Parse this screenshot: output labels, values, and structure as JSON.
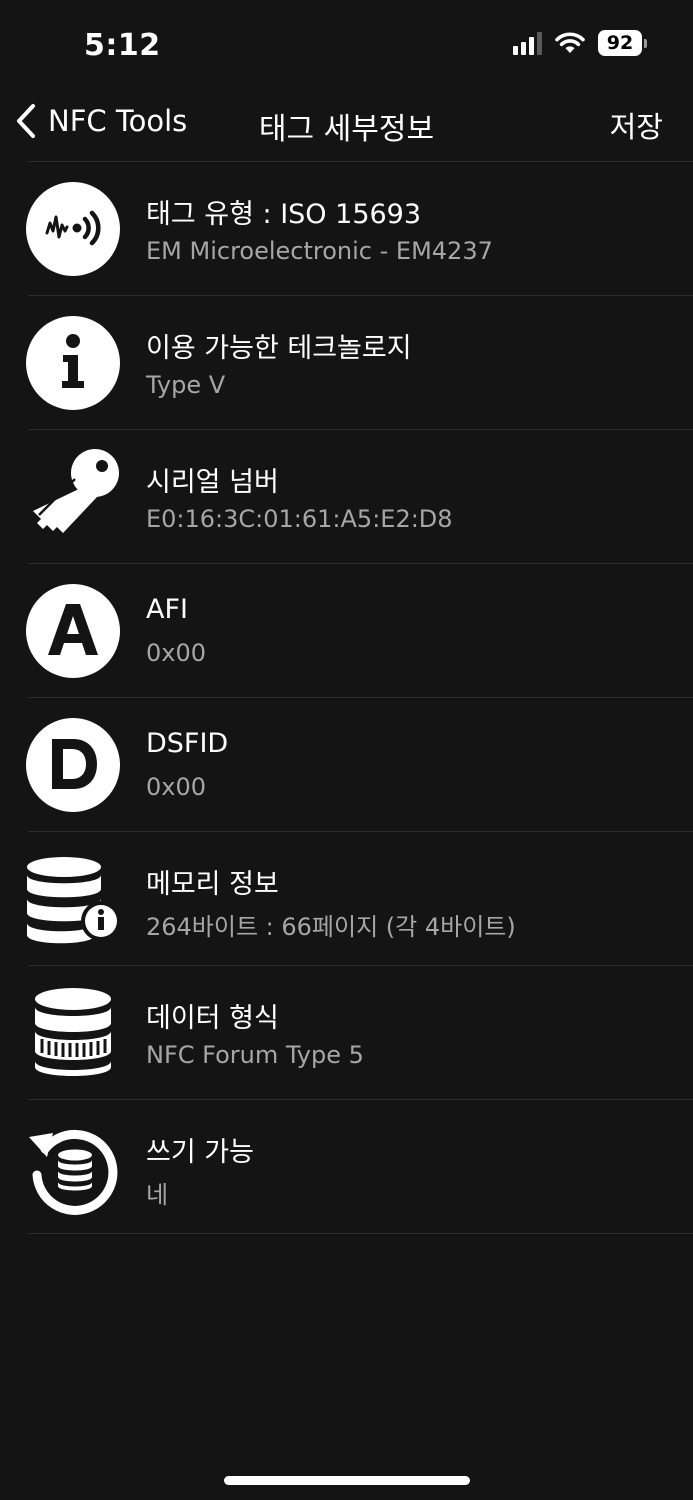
{
  "status_bar": {
    "time": "5:12",
    "battery": "92",
    "icons": [
      "signal-icon",
      "wifi-icon",
      "battery-icon"
    ]
  },
  "nav": {
    "back_label": "NFC Tools",
    "title": "태그 세부정보",
    "save_label": "저장"
  },
  "items": [
    {
      "icon": "nfc-wave-icon",
      "title": "태그 유형 : ISO 15693",
      "subtitle": "EM Microelectronic - EM4237"
    },
    {
      "icon": "info-icon",
      "title": "이용 가능한 테크놀로지",
      "subtitle": "Type V"
    },
    {
      "icon": "key-icon",
      "title": "시리얼 넘버",
      "subtitle": "E0:16:3C:01:61:A5:E2:D8"
    },
    {
      "icon": "letter-a-icon",
      "title": "AFI",
      "subtitle": "0x00"
    },
    {
      "icon": "letter-d-icon",
      "title": "DSFID",
      "subtitle": "0x00"
    },
    {
      "icon": "database-info-icon",
      "title": "메모리 정보",
      "subtitle": "264바이트 : 66페이지 (각 4바이트)"
    },
    {
      "icon": "database-icon",
      "title": "데이터 형식",
      "subtitle": "NFC Forum Type 5"
    },
    {
      "icon": "writable-icon",
      "title": "쓰기 가능",
      "subtitle": "네"
    }
  ],
  "colors": {
    "background": "#141414",
    "text": "#ffffff",
    "subtext": "#a6a6a6",
    "divider": "#2c2c2c"
  }
}
